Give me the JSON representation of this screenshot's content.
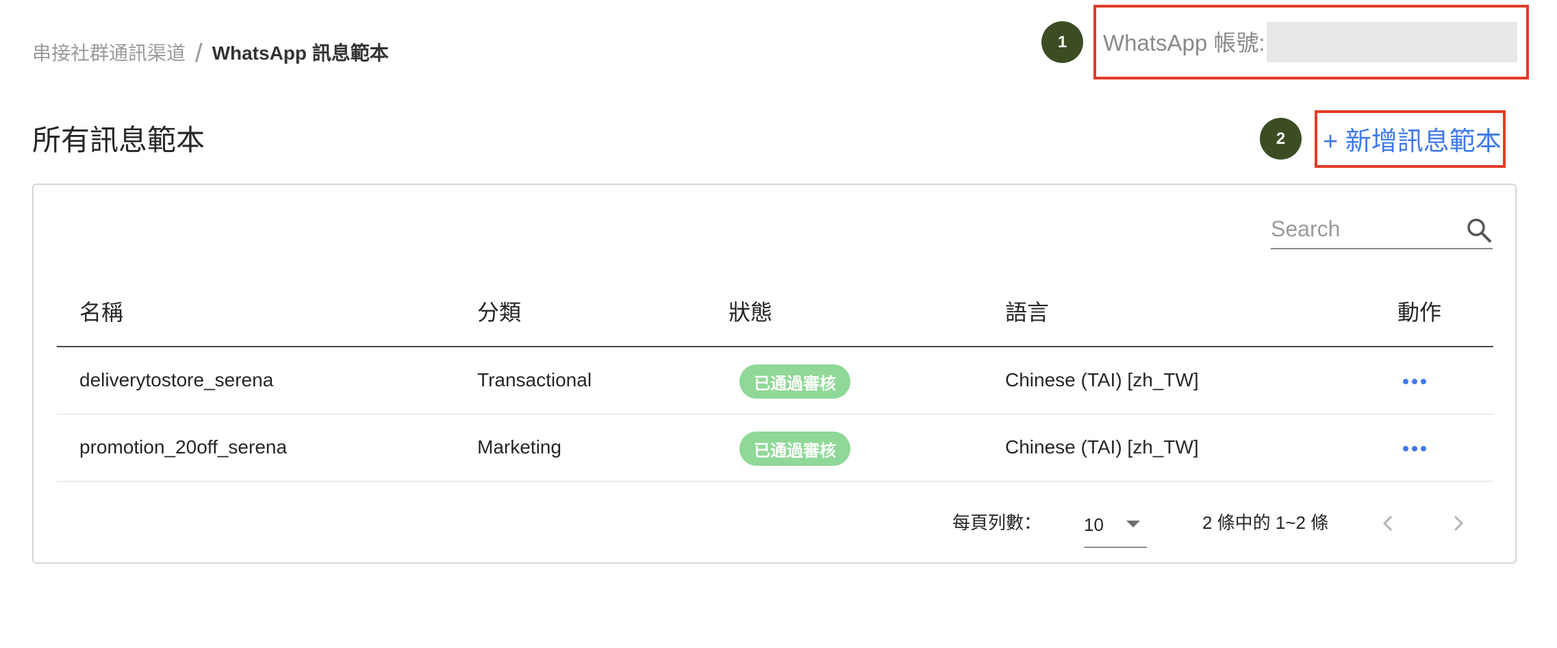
{
  "breadcrumb": {
    "parent": "串接社群通訊渠道",
    "separator": "/",
    "current": "WhatsApp 訊息範本"
  },
  "callouts": [
    "1",
    "2"
  ],
  "account": {
    "label": "WhatsApp 帳號:",
    "value": ""
  },
  "section_title": "所有訊息範本",
  "add_button": "+ 新增訊息範本",
  "search": {
    "placeholder": "Search"
  },
  "table": {
    "headers": {
      "name": "名稱",
      "category": "分類",
      "status": "狀態",
      "language": "語言",
      "action": "動作"
    },
    "rows": [
      {
        "name": "deliverytostore_serena",
        "category": "Transactional",
        "status": "已通過審核",
        "language": "Chinese (TAI) [zh_TW]"
      },
      {
        "name": "promotion_20off_serena",
        "category": "Marketing",
        "status": "已通過審核",
        "language": "Chinese (TAI) [zh_TW]"
      }
    ]
  },
  "pagination": {
    "rows_per_page_label": "每頁列數：",
    "rows_per_page": "10",
    "range": "2 條中的 1~2 條"
  },
  "colors": {
    "accent": "#3f7ae8",
    "status_approved": "#8fd897",
    "callout_badge": "#3c4d23",
    "highlight_border": "#e23b26"
  }
}
